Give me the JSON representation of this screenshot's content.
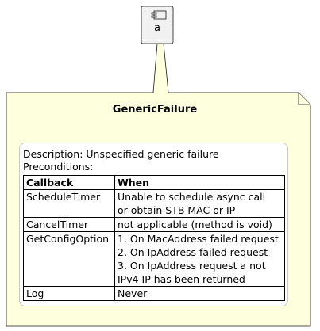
{
  "component": {
    "label": "a"
  },
  "note": {
    "title": "GenericFailure",
    "description": "Description: Unspecified generic failure",
    "preconditions": "Preconditions:",
    "table": {
      "headers": [
        "Callback",
        "When"
      ],
      "rows": [
        {
          "callback": "ScheduleTimer",
          "when": [
            "Unable to schedule async call",
            "or obtain STB MAC or IP"
          ]
        },
        {
          "callback": "CancelTimer",
          "when": [
            "not applicable (method is void)"
          ]
        },
        {
          "callback": "GetConfigOption",
          "when": [
            "1. On MacAddress failed request",
            "2. On IpAddress failed request",
            "3. On IpAddress request a not",
            "IPv4 IP has been returned"
          ]
        },
        {
          "callback": "Log",
          "when": [
            "Never"
          ]
        }
      ]
    }
  },
  "colors": {
    "component_fill": "#F1F1F1",
    "component_stroke": "#181818",
    "note_fill": "#FEFFDD",
    "note_stroke": "#181818"
  }
}
